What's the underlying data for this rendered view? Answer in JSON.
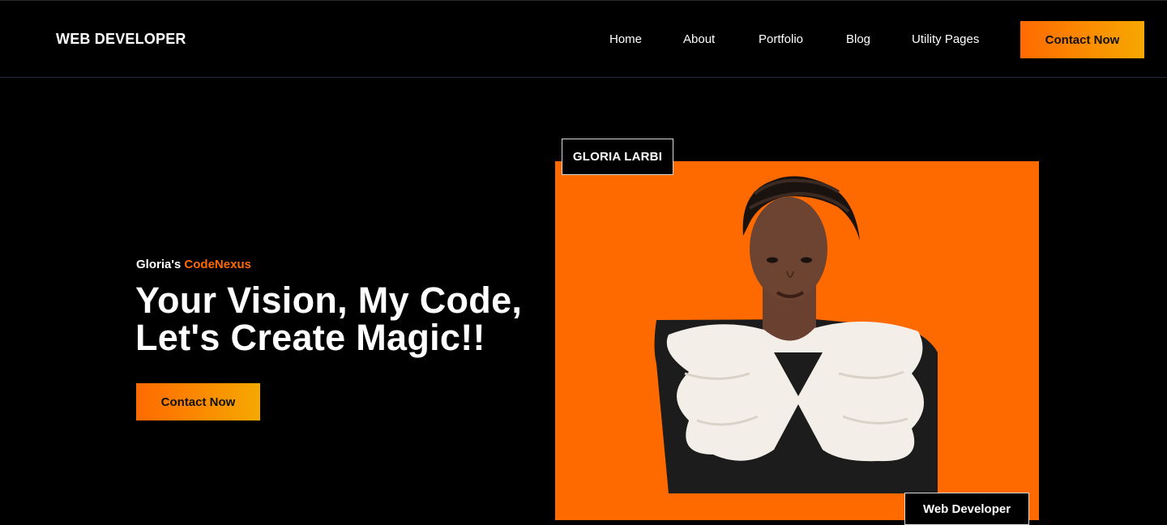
{
  "header": {
    "brand": "WEB DEVELOPER",
    "nav": [
      {
        "label": "Home"
      },
      {
        "label": "About"
      },
      {
        "label": "Portfolio"
      },
      {
        "label": "Blog"
      },
      {
        "label": "Utility Pages"
      }
    ],
    "cta_label": "Contact Now"
  },
  "hero": {
    "tagline_prefix": "Gloria's ",
    "tagline_accent": "CodeNexus",
    "title_line1": "Your Vision, My Code,",
    "title_line2": "Let's Create Magic!!",
    "cta_label": "Contact Now"
  },
  "profile": {
    "name": "GLORIA LARBI",
    "role": "Web Developer"
  },
  "colors": {
    "background": "#000000",
    "accent": "#ff6a00",
    "gradient_end": "#f6a800",
    "text": "#ffffff"
  }
}
